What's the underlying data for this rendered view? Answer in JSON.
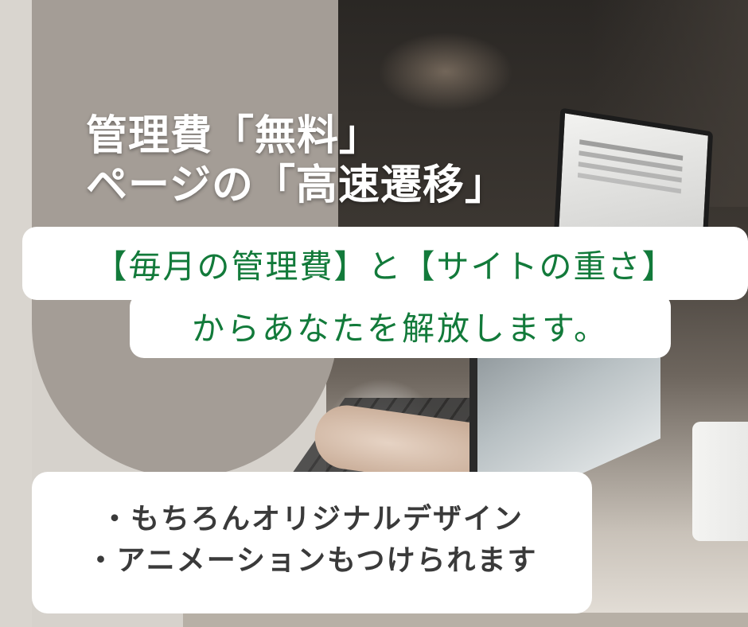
{
  "headline": {
    "line1": "管理費「無料」",
    "line2": "ページの「高速遷移」"
  },
  "message": {
    "line1": "【毎月の管理費】と【サイトの重さ】",
    "line2": "からあなたを解放します。"
  },
  "bullets": [
    "・もちろんオリジナルデザイン",
    "・アニメーションもつけられます"
  ],
  "colors": {
    "accent_green": "#127a3a",
    "arch_taupe": "#a49d96",
    "background": "#d6d2cc",
    "bullet_text": "#3a3a3a"
  }
}
